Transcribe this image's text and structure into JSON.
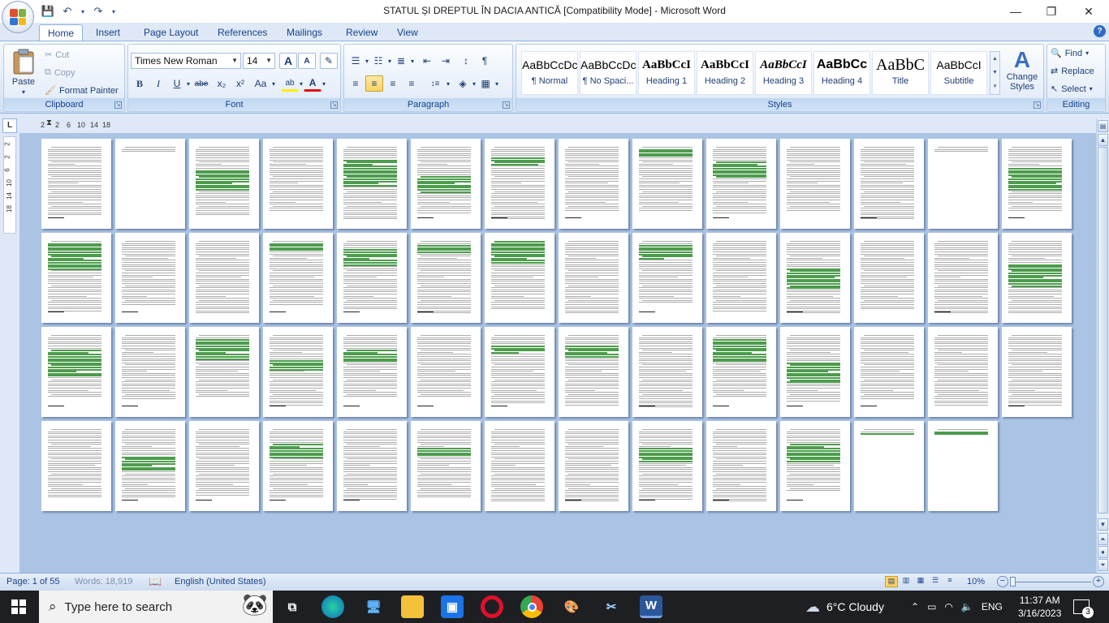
{
  "window": {
    "title": "STATUL ȘI DREPTUL ÎN DACIA ANTICĂ [Compatibility Mode] - Microsoft Word",
    "minimize": "—",
    "restore": "❐",
    "close": "✕"
  },
  "quick_access": {
    "save_icon": "💾",
    "undo_icon": "↶",
    "redo_icon": "↷",
    "customize_icon": "▾"
  },
  "tabs": [
    {
      "label": "Home",
      "active": true
    },
    {
      "label": "Insert"
    },
    {
      "label": "Page Layout"
    },
    {
      "label": "References"
    },
    {
      "label": "Mailings"
    },
    {
      "label": "Review"
    },
    {
      "label": "View"
    }
  ],
  "help_icon": "?",
  "clipboard": {
    "group_label": "Clipboard",
    "paste": "Paste",
    "cut": "Cut",
    "copy": "Copy",
    "format_painter": "Format Painter"
  },
  "font": {
    "group_label": "Font",
    "family": "Times New Roman",
    "size": "14",
    "grow": "A",
    "shrink": "A",
    "clear": "✎",
    "bold": "B",
    "italic": "I",
    "underline": "U",
    "strike": "abe",
    "subscript": "x₂",
    "superscript": "x²",
    "change_case": "Aa",
    "highlight": "ab",
    "font_color": "A"
  },
  "paragraph": {
    "group_label": "Paragraph",
    "bullets": "☰",
    "numbering": "☷",
    "multilevel": "≣",
    "decrease_indent": "⇤",
    "increase_indent": "⇥",
    "sort": "↕",
    "show_marks": "¶",
    "align_left": "≡",
    "center": "≡",
    "align_right": "≡",
    "justify": "≡",
    "line_spacing": "↕≡",
    "shading": "◈",
    "borders": "▦"
  },
  "styles": {
    "group_label": "Styles",
    "items": [
      {
        "preview": "AaBbCcDc",
        "name": "¶ Normal"
      },
      {
        "preview": "AaBbCcDc",
        "name": "¶ No Spaci..."
      },
      {
        "preview": "AaBbCcI",
        "name": "Heading 1"
      },
      {
        "preview": "AaBbCcI",
        "name": "Heading 2"
      },
      {
        "preview": "AaBbCcI",
        "name": "Heading 3"
      },
      {
        "preview": "AaBbCc",
        "name": "Heading 4"
      },
      {
        "preview": "AaBbC",
        "name": "Title"
      },
      {
        "preview": "AaBbCcI",
        "name": "Subtitle"
      }
    ],
    "change_styles": "Change Styles"
  },
  "editing": {
    "group_label": "Editing",
    "find": "Find",
    "replace": "Replace",
    "select": "Select"
  },
  "ruler": {
    "corner": "L",
    "h_ticks": [
      "2",
      "2",
      "6",
      "10",
      "14",
      "18"
    ],
    "v_ticks": [
      "2",
      "2",
      "6",
      "10",
      "14",
      "18"
    ]
  },
  "statusbar": {
    "page": "Page: 1 of 55",
    "words": "Words: 18,919",
    "language": "English (United States)",
    "zoom": "10%"
  },
  "taskbar": {
    "search_placeholder": "Type here to search",
    "weather": "6°C  Cloudy",
    "lang": "ENG",
    "time": "11:37 AM",
    "date": "3/16/2023",
    "notifications": "3"
  },
  "colors": {
    "ribbon_bg": "#dfe8f6",
    "accent_text": "#15428b",
    "doc_bg": "#abc4e4",
    "highlight_green": "#2e8b2e",
    "taskbar": "#1e1f22"
  }
}
